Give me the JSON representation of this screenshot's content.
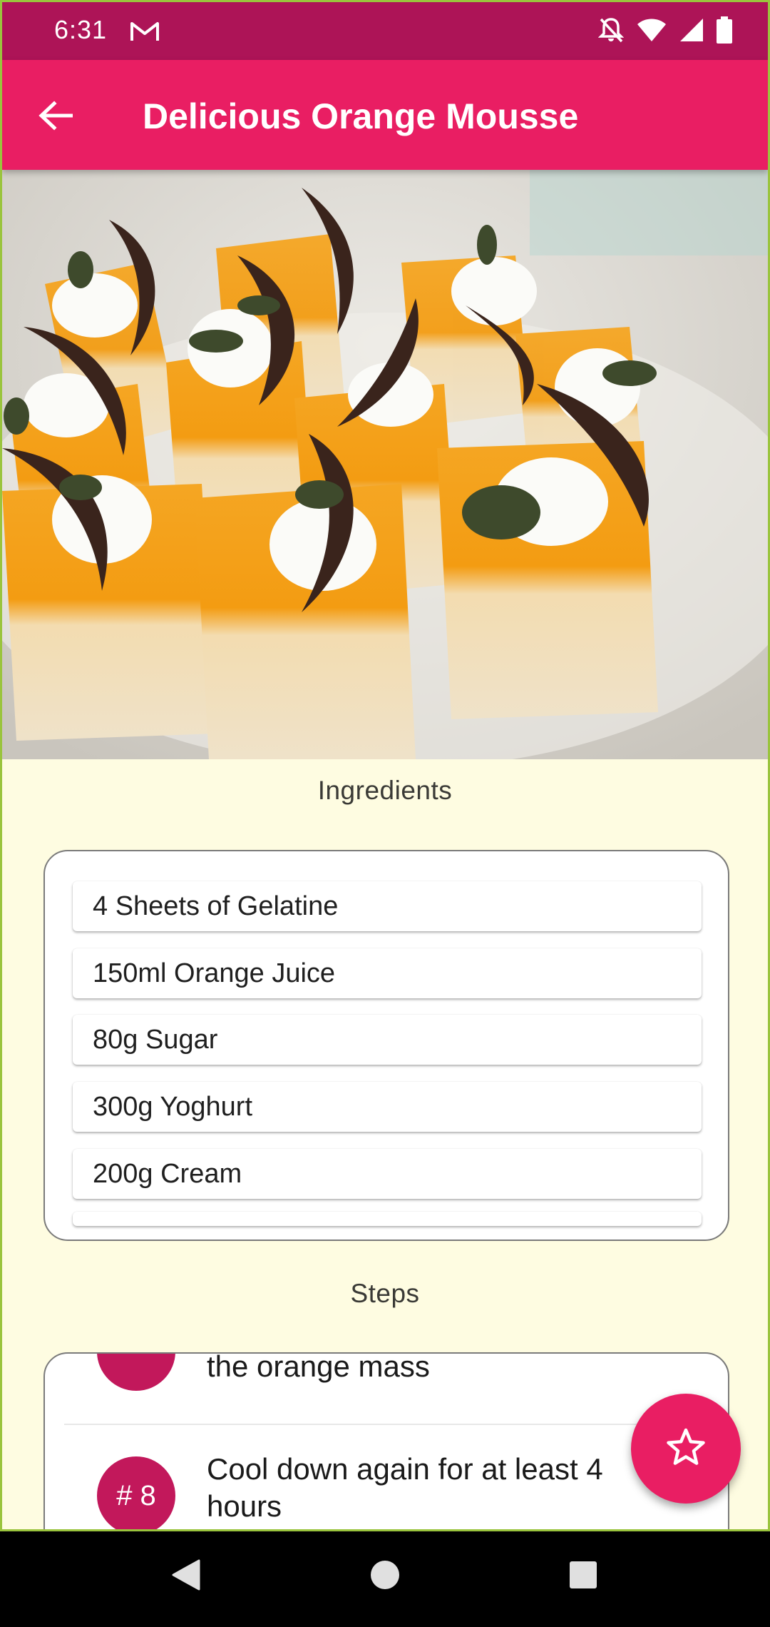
{
  "status_bar": {
    "time": "6:31",
    "notification_icon": "gmail-icon",
    "icons": [
      "notifications-off-icon",
      "wifi-icon",
      "signal-icon",
      "battery-icon"
    ]
  },
  "app_bar": {
    "title": "Delicious Orange Mousse",
    "back_icon": "arrow-back-icon",
    "background_color": "#E91E63"
  },
  "hero_image": {
    "description_icon": "orange-mousse-dessert-photo"
  },
  "ingredients": {
    "heading": "Ingredients",
    "items": [
      "4 Sheets of Gelatine",
      "150ml Orange Juice",
      "80g Sugar",
      "300g Yoghurt",
      "200g Cream"
    ]
  },
  "steps": {
    "heading": "Steps",
    "items": [
      {
        "number": "",
        "text": "the orange mass"
      },
      {
        "number": "# 8",
        "text": "Cool down again for at least 4 hours"
      }
    ]
  },
  "fab": {
    "icon": "star-outline-icon",
    "color": "#E91E63"
  },
  "nav_bar": {
    "icons": [
      "back-triangle-icon",
      "home-circle-icon",
      "recents-square-icon"
    ]
  }
}
